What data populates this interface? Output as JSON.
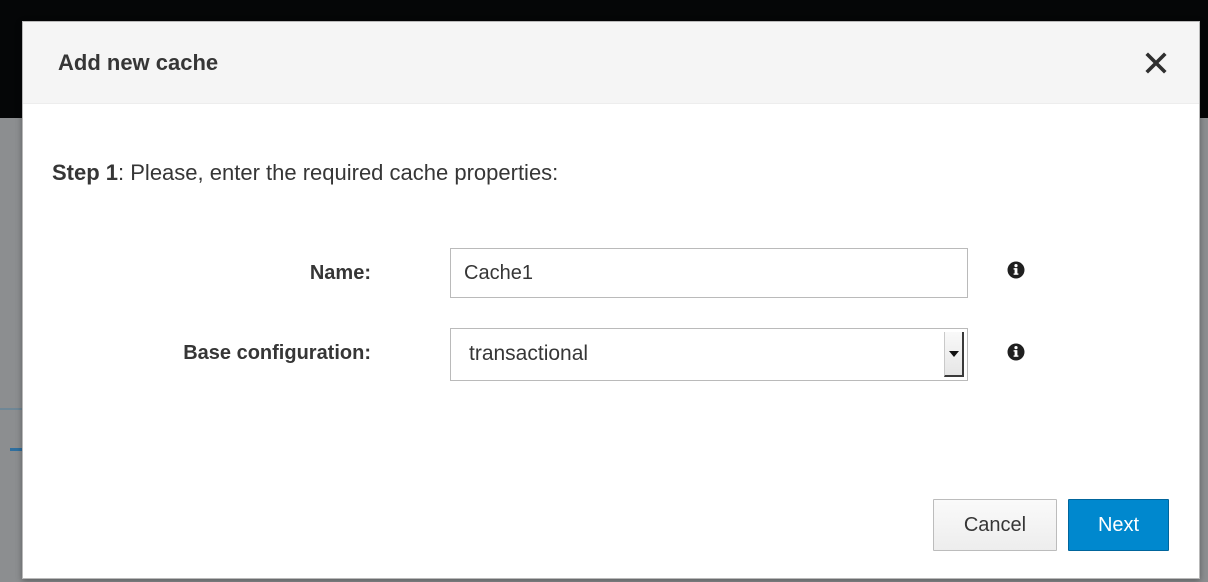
{
  "dialog": {
    "title": "Add new cache",
    "close_icon": "close-icon"
  },
  "step": {
    "number_label": "Step 1",
    "instruction": ": Please, enter the required cache properties:"
  },
  "form": {
    "name": {
      "label": "Name:",
      "value": "Cache1",
      "info_icon": "info-icon"
    },
    "base_configuration": {
      "label": "Base configuration:",
      "selected": "transactional",
      "info_icon": "info-icon"
    }
  },
  "buttons": {
    "cancel": "Cancel",
    "next": "Next"
  },
  "colors": {
    "primary": "#0088ce",
    "backdrop": "#8c8e90",
    "text": "#363636"
  }
}
